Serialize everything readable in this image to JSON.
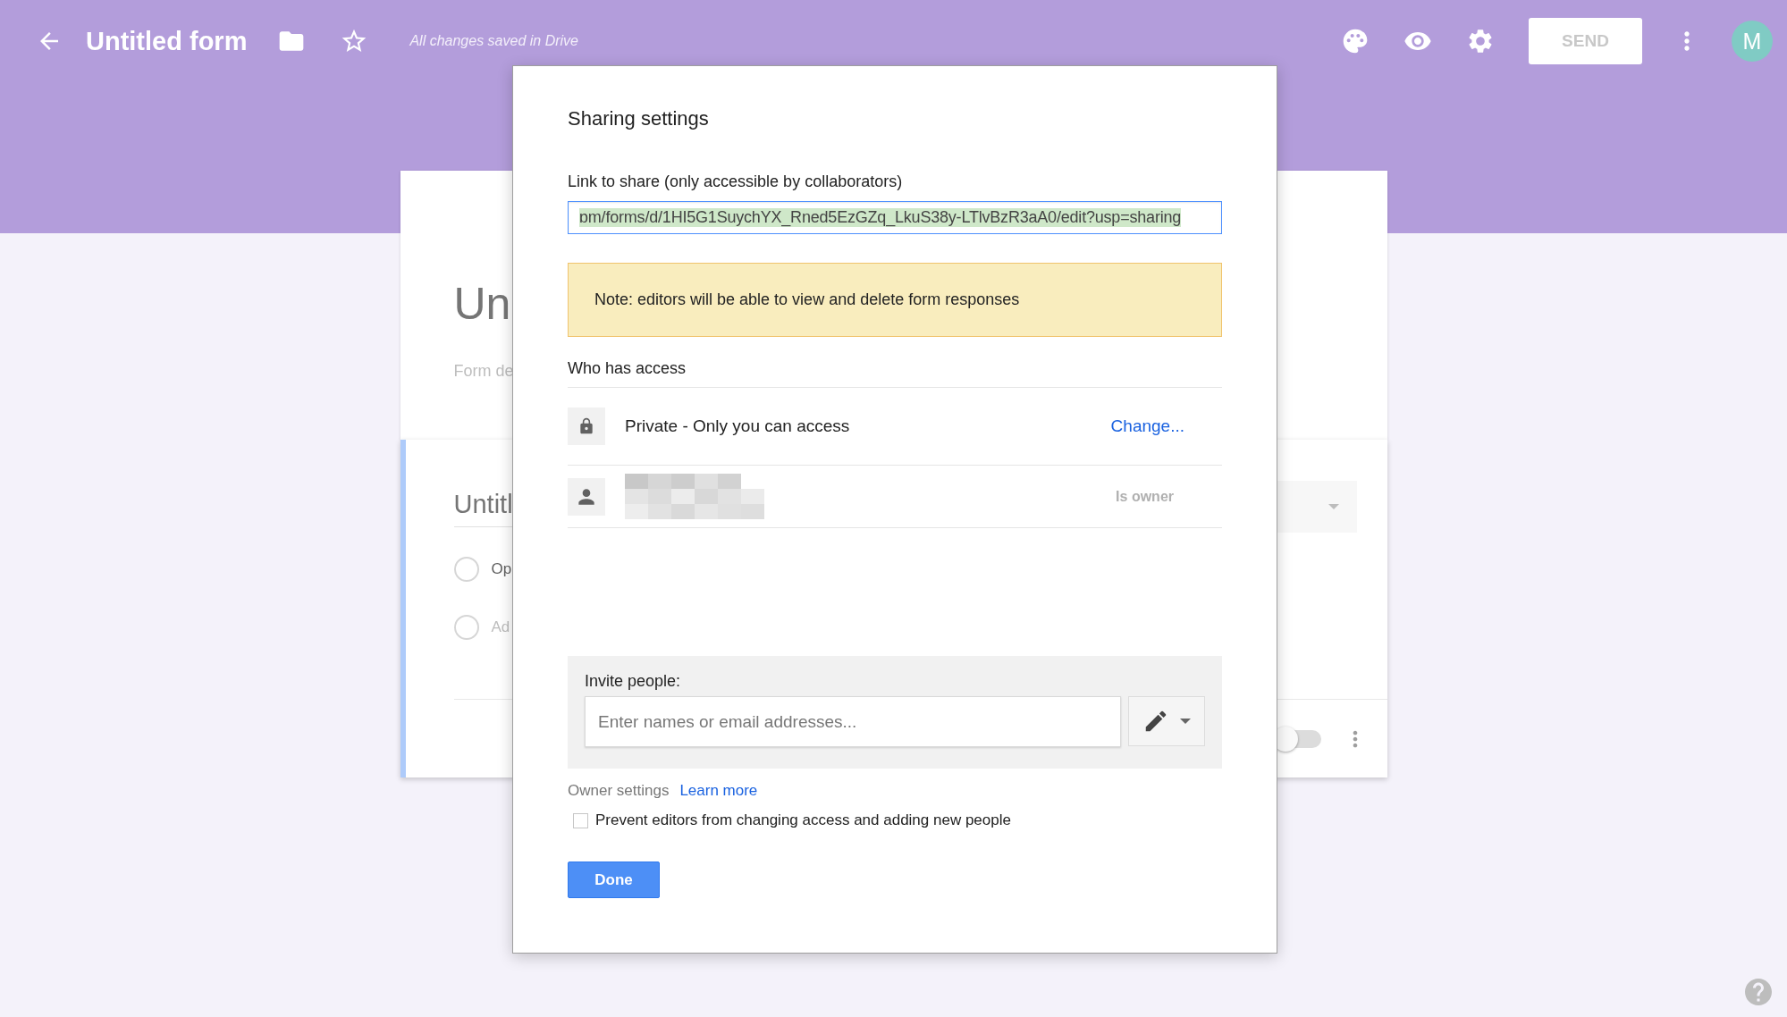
{
  "header": {
    "title": "Untitled form",
    "save_status": "All changes saved in Drive",
    "send_button": "SEND",
    "avatar": "M"
  },
  "form_preview": {
    "title": "Un",
    "description": "Form de",
    "question": "Untitl",
    "options": [
      {
        "label": "Op",
        "selected": false
      },
      {
        "label": "Ad",
        "selected": false
      }
    ],
    "required_on": false
  },
  "dialog": {
    "title": "Sharing settings",
    "link_label": "Link to share (only accessible by collaborators)",
    "link_value": "ɒm/forms/d/1HI5G1SuychYX_Rned5EzGZq_LkuS38y-LTlvBzR3aA0/edit?usp=sharing",
    "note": "Note: editors will be able to view and delete form responses",
    "access_heading": "Who has access",
    "access": [
      {
        "kind": "link",
        "text": "Private - Only you can access",
        "action": "Change..."
      },
      {
        "kind": "person",
        "role": "Is owner"
      }
    ],
    "invite": {
      "label": "Invite people:",
      "placeholder": "Enter names or email addresses..."
    },
    "owner_settings": {
      "label": "Owner settings",
      "link": "Learn more",
      "prevent_editors": {
        "label": "Prevent editors from changing access and adding new people",
        "checked": false
      }
    },
    "done": "Done"
  }
}
